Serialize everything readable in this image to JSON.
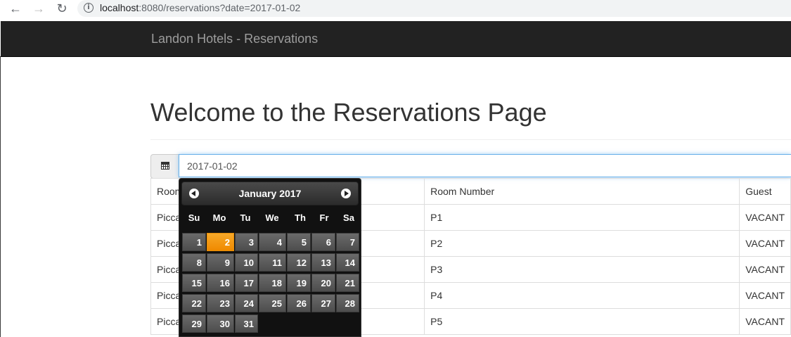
{
  "browser": {
    "url_host": "localhost",
    "url_rest": ":8080/reservations?date=2017-01-02"
  },
  "navbar": {
    "brand": "Landon Hotels - Reservations"
  },
  "page": {
    "title": "Welcome to the Reservations Page"
  },
  "date_input": {
    "value": "2017-01-02"
  },
  "table": {
    "headers": [
      "Room",
      "Room Number",
      "Guest"
    ],
    "rows": [
      [
        "Picca",
        "P1",
        "VACANT"
      ],
      [
        "Picca",
        "P2",
        "VACANT"
      ],
      [
        "Picca",
        "P3",
        "VACANT"
      ],
      [
        "Picca",
        "P4",
        "VACANT"
      ],
      [
        "Picca",
        "P5",
        "VACANT"
      ]
    ]
  },
  "datepicker": {
    "title": "January 2017",
    "weekdays": [
      "Su",
      "Mo",
      "Tu",
      "We",
      "Th",
      "Fr",
      "Sa"
    ],
    "days": [
      "1",
      "2",
      "3",
      "4",
      "5",
      "6",
      "7",
      "8",
      "9",
      "10",
      "11",
      "12",
      "13",
      "14",
      "15",
      "16",
      "17",
      "18",
      "19",
      "20",
      "21",
      "22",
      "23",
      "24",
      "25",
      "26",
      "27",
      "28",
      "29",
      "30",
      "31"
    ],
    "selected_day": "2",
    "active_color": "#f08a00"
  }
}
